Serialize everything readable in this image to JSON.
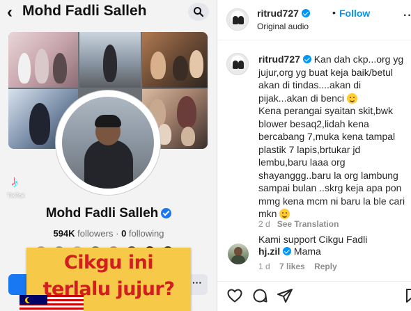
{
  "left_panel": {
    "header_title": "Mohd Fadli Salleh",
    "tiktok_icon": "♪",
    "tiktok_watermark": "TikTok",
    "profile_name": "Mohd Fadli Salleh",
    "followers_count": "594K",
    "followers_label": "followers",
    "following_count": "0",
    "following_label": "following",
    "separator": "·",
    "more_label": "···",
    "caption_line1": "Cikgu ini",
    "caption_line2": "terlalu jujur?",
    "caption_bg": "#f7c948",
    "caption_color": "#d11e1e",
    "fb_blue": "#1877f2"
  },
  "post_header": {
    "username": "ritrud727",
    "separator": "•",
    "follow_label": "Follow",
    "audio_label": "Original audio",
    "more_label": "···"
  },
  "main_comment": {
    "username": "ritrud727",
    "text_part1": "Kan dah ckp...org yg jujur,org yg buat keja baik/betul akan di tindas....akan di pijak...akan di benci",
    "text_part2": "Kena perangai syaitan skit,bwk blower besaq2,lidah kena bercabang 7,muka kena tampal plastik 7 lapis,brtukar jd lembu,baru laaa org shayanggg..baru la org lambung sampai bulan ..skrg keja apa pon mmg kena mcm ni baru la ble cari mkn",
    "text_part3": "Kami support Cikgu Fadli",
    "time": "2 d",
    "see_translation": "See Translation"
  },
  "reply_comment": {
    "username": "hj.zil",
    "text": "Mama",
    "time": "1 d",
    "likes": "7 likes",
    "reply_label": "Reply"
  },
  "actions": [
    "heart-icon",
    "comment-icon",
    "share-icon",
    "bookmark-icon"
  ],
  "colors": {
    "ig_blue": "#0095f6",
    "ig_text": "#262626",
    "ig_meta": "#8e8e8e"
  }
}
